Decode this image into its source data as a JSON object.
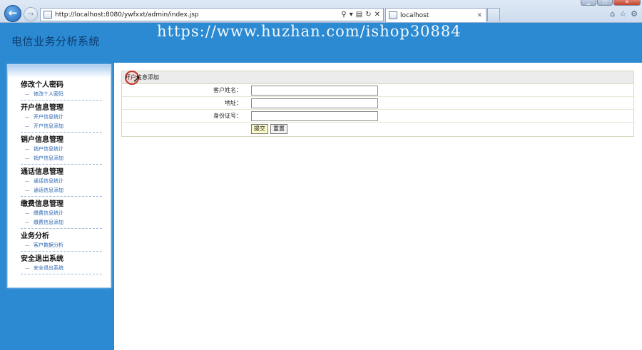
{
  "browser": {
    "url": "http://localhost:8080/ywfxxt/admin/index.jsp",
    "tab_title": "localhost"
  },
  "header": {
    "title": "电信业务分析系统",
    "watermark": "https://www.huzhan.com/ishop30884"
  },
  "sidebar": {
    "groups": [
      {
        "title": "修改个人密码",
        "items": [
          "修改个人密码"
        ]
      },
      {
        "title": "开户信息管理",
        "items": [
          "开户信息统计",
          "开户信息添加"
        ]
      },
      {
        "title": "销户信息管理",
        "items": [
          "销户信息统计",
          "销户信息添加"
        ]
      },
      {
        "title": "通话信息管理",
        "items": [
          "通话信息统计",
          "通话信息添加"
        ]
      },
      {
        "title": "缴费信息管理",
        "items": [
          "缴费信息统计",
          "缴费信息添加"
        ]
      },
      {
        "title": "业务分析",
        "items": [
          "客户数据分析"
        ]
      },
      {
        "title": "安全退出系统",
        "items": [
          "安全退出系统"
        ]
      }
    ]
  },
  "form": {
    "title": "开户信息添加",
    "fields": [
      {
        "label": "客户姓名：",
        "value": ""
      },
      {
        "label": "地址：",
        "value": ""
      },
      {
        "label": "身份证号：",
        "value": ""
      }
    ],
    "submit_label": "提交",
    "reset_label": "重置"
  }
}
